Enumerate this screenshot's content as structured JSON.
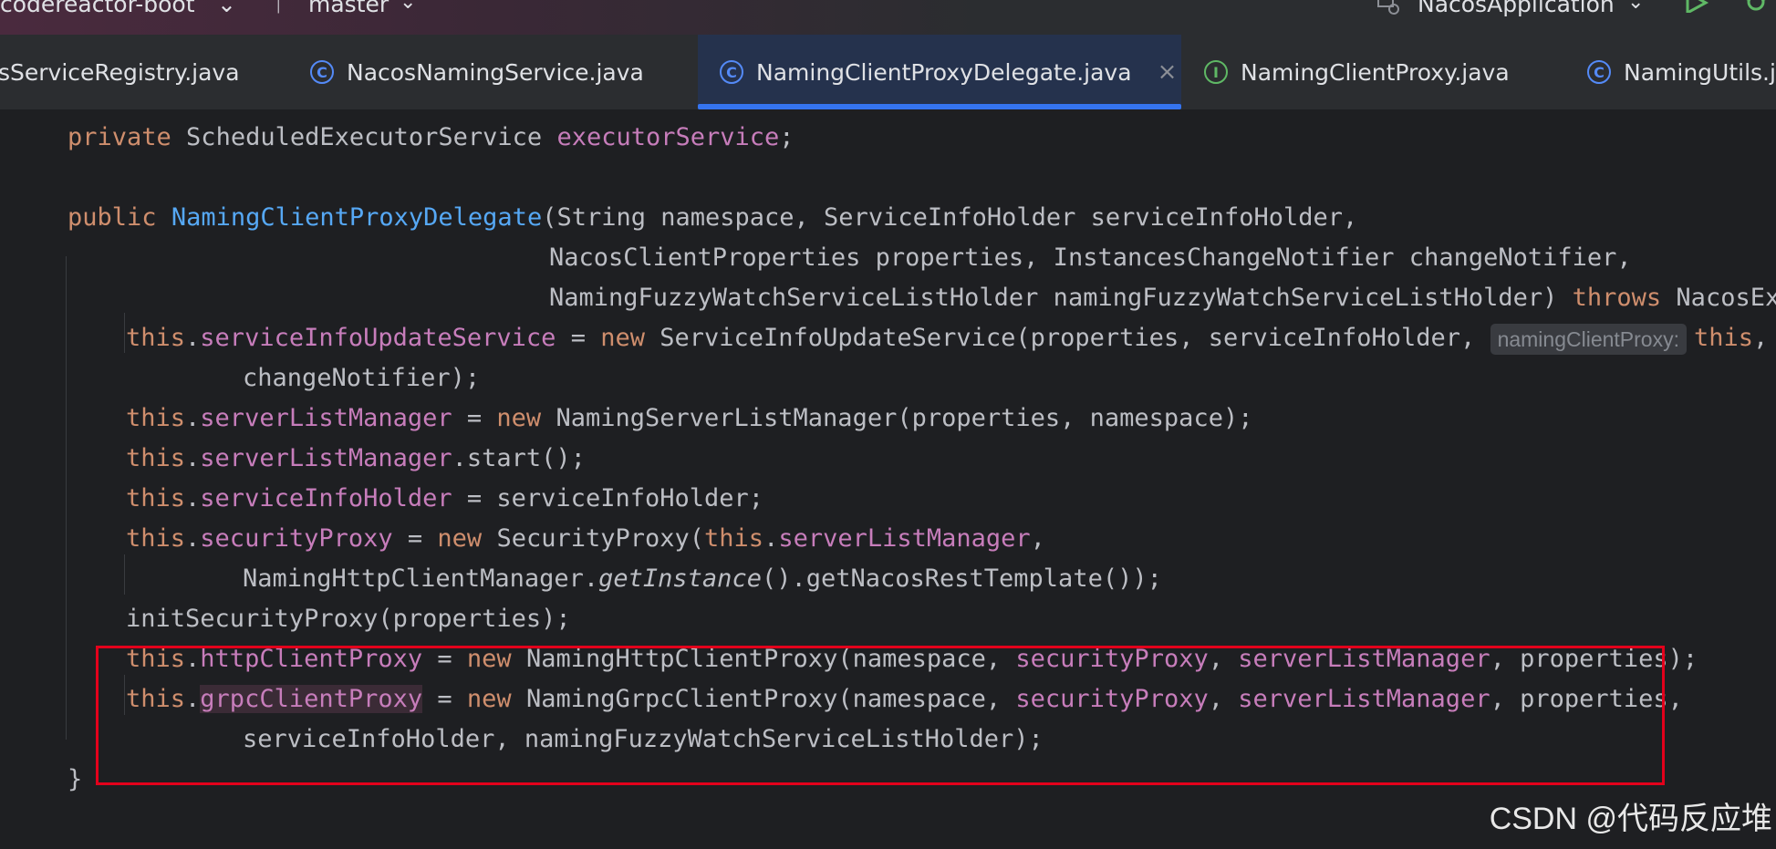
{
  "toolbar": {
    "project_name": "codereactor-boot",
    "branch": "master",
    "run_config": "NacosApplication",
    "chevron": "⌄",
    "icons": [
      "branch-icon",
      "run-config-icon",
      "run-icon",
      "debug-icon"
    ]
  },
  "tabs": [
    {
      "label": "sServiceRegistry.java",
      "icon": "class",
      "icon_letter": ""
    },
    {
      "label": "NacosNamingService.java",
      "icon": "class",
      "icon_letter": "C"
    },
    {
      "label": "NamingClientProxyDelegate.java",
      "icon": "class",
      "icon_letter": "C",
      "active": true,
      "close": "×"
    },
    {
      "label": "NamingClientProxy.java",
      "icon": "interface",
      "icon_letter": "I"
    },
    {
      "label": "NamingUtils.ja",
      "icon": "class",
      "icon_letter": "C"
    }
  ],
  "code": {
    "l1": {
      "kw": "private",
      "type": " ScheduledExecutorService ",
      "field": "executorService",
      "end": ";"
    },
    "l2": {
      "kw": "public",
      "method": "NamingClientProxyDelegate",
      "rest": "(String namespace, ServiceInfoHolder serviceInfoHolder,"
    },
    "l3": {
      "text": "NacosClientProperties properties, InstancesChangeNotifier changeNotifier,"
    },
    "l4": {
      "text": "NamingFuzzyWatchServiceListHolder namingFuzzyWatchServiceListHolder) ",
      "kw": "throws",
      "rest": " NacosExc"
    },
    "l5": {
      "this": "this",
      "field": "serviceInfoUpdateService",
      "eq": " = ",
      "new": "new",
      "rest": " ServiceInfoUpdateService(properties, serviceInfoHolder, ",
      "hint": "namingClientProxy:",
      "this2": "this",
      ",": ","
    },
    "l6": {
      "text": "changeNotifier);"
    },
    "l7": {
      "this": "this",
      "field": "serverListManager",
      "eq": " = ",
      "new": "new",
      "rest": " NamingServerListManager(properties, namespace);"
    },
    "l8": {
      "this": "this",
      "field": "serverListManager",
      "rest": ".start();"
    },
    "l9": {
      "this": "this",
      "field": "serviceInfoHolder",
      "rest": " = serviceInfoHolder;"
    },
    "l10": {
      "this": "this",
      "field": "securityProxy",
      "eq": " = ",
      "new": "new",
      "rest": " SecurityProxy(",
      "this2": "this",
      "field2": "serverListManager",
      "end": ","
    },
    "l11": {
      "pre": "NamingHttpClientManager.",
      "italic": "getInstance",
      "rest": "().getNacosRestTemplate());"
    },
    "l12": {
      "text": "initSecurityProxy(properties);"
    },
    "l13": {
      "this": "this",
      "field": "httpClientProxy",
      "eq": " = ",
      "new": "new",
      "rest": " NamingHttpClientProxy(namespace, ",
      "f1": "securityProxy",
      "c1": ", ",
      "f2": "serverListManager",
      "end": ", properties);"
    },
    "l14": {
      "this": "this",
      "field": "grpcClientProxy",
      "eq": " = ",
      "new": "new",
      "rest": " NamingGrpcClientProxy(namespace, ",
      "f1": "securityProxy",
      "c1": ", ",
      "f2": "serverListManager",
      "end": ", properties,"
    },
    "l15": {
      "text": "serviceInfoHolder, namingFuzzyWatchServiceListHolder);"
    },
    "l16": {
      "text": "}"
    }
  },
  "watermark": "CSDN @代码反应堆",
  "colors": {
    "keyword": "#cf8e6d",
    "field": "#c77dbb",
    "method": "#56a8f5",
    "text": "#bcbec4",
    "accent": "#3574f0",
    "highlight_box": "#e3001b"
  }
}
